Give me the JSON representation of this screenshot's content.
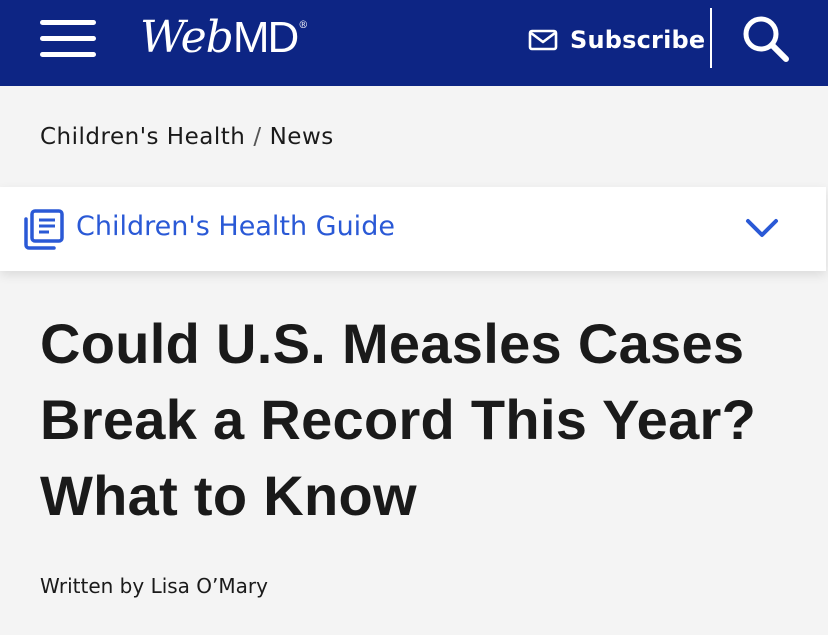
{
  "header": {
    "logo_web": "Web",
    "logo_md": "MD",
    "logo_reg": "®",
    "subscribe_label": "Subscribe",
    "icons": [
      "menu-icon",
      "mail-icon",
      "search-icon"
    ],
    "background_color": "#0d2584"
  },
  "breadcrumb": {
    "items": [
      "Children's Health",
      "News"
    ],
    "separator": "/"
  },
  "guide": {
    "label": "Children's Health Guide",
    "icons": [
      "guide-icon",
      "chevron-down-icon"
    ],
    "accent_color": "#2a59d6"
  },
  "article": {
    "headline_line1": "Could U.S. Measles Cases",
    "headline_line2": "Break a Record This Year?",
    "headline_line3": "What to Know",
    "byline": "Written by Lisa O’Mary"
  }
}
